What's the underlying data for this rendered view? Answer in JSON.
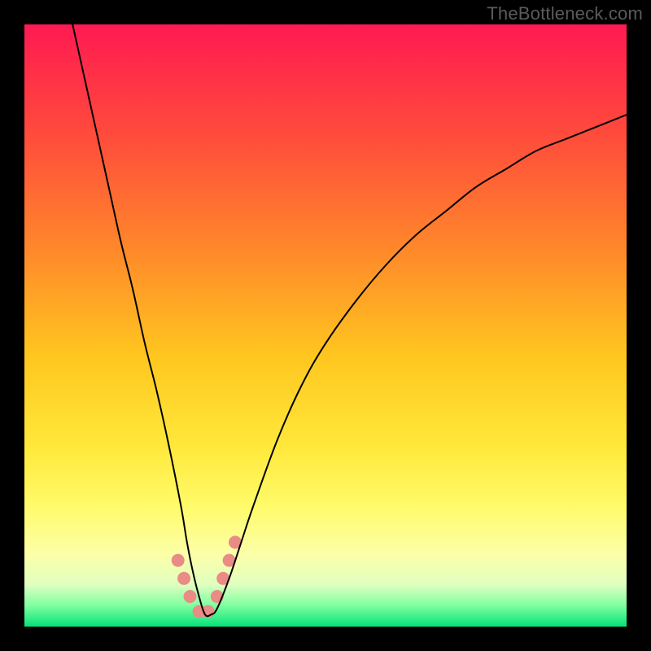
{
  "watermark": "TheBottleneck.com",
  "chart_data": {
    "type": "line",
    "title": "",
    "xlabel": "",
    "ylabel": "",
    "xlim": [
      0,
      100
    ],
    "ylim": [
      0,
      100
    ],
    "grid": false,
    "legend": false,
    "background_gradient_stops": [
      {
        "pos": 0.0,
        "color": "#ff1a52"
      },
      {
        "pos": 0.18,
        "color": "#ff4a3c"
      },
      {
        "pos": 0.38,
        "color": "#ff8a2a"
      },
      {
        "pos": 0.55,
        "color": "#ffc61f"
      },
      {
        "pos": 0.7,
        "color": "#ffe83a"
      },
      {
        "pos": 0.8,
        "color": "#fffb6a"
      },
      {
        "pos": 0.88,
        "color": "#fcffa8"
      },
      {
        "pos": 0.93,
        "color": "#e0ffc0"
      },
      {
        "pos": 0.965,
        "color": "#7fffa0"
      },
      {
        "pos": 1.0,
        "color": "#05e27a"
      }
    ],
    "series": [
      {
        "name": "bottleneck-curve",
        "color": "#000000",
        "width": 2,
        "x": [
          8,
          10,
          12,
          14,
          16,
          18,
          20,
          22,
          24,
          26,
          27,
          28,
          29,
          30,
          31,
          32,
          34,
          36,
          38,
          42,
          46,
          50,
          55,
          60,
          65,
          70,
          75,
          80,
          85,
          90,
          95,
          100
        ],
        "y": [
          100,
          91,
          82,
          73,
          64,
          56,
          47,
          39,
          30,
          20,
          14,
          9,
          5,
          2,
          2,
          3,
          8,
          14,
          20,
          31,
          40,
          47,
          54,
          60,
          65,
          69,
          73,
          76,
          79,
          81,
          83,
          85
        ]
      }
    ],
    "markers": [
      {
        "name": "bottom-cluster",
        "color": "#e98c86",
        "size": 10,
        "points": [
          {
            "x": 25.5,
            "y": 11
          },
          {
            "x": 26.5,
            "y": 8
          },
          {
            "x": 27.5,
            "y": 5
          },
          {
            "x": 29.0,
            "y": 2.5
          },
          {
            "x": 30.5,
            "y": 2.5
          },
          {
            "x": 32.0,
            "y": 5
          },
          {
            "x": 33.0,
            "y": 8
          },
          {
            "x": 34.0,
            "y": 11
          },
          {
            "x": 35.0,
            "y": 14
          }
        ]
      }
    ]
  }
}
